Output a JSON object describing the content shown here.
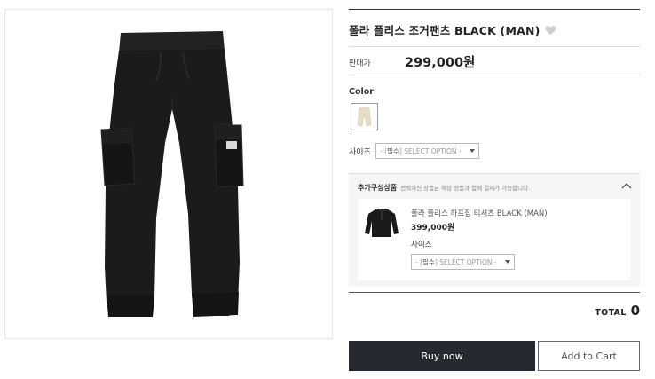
{
  "product": {
    "title": "폴라 플리스 조거팬츠 BLACK (MAN)",
    "price_label": "판매가",
    "price": "299,000원",
    "color_label": "Color",
    "size_label": "사이즈",
    "size_select": {
      "prefix": "- [",
      "required": "필수",
      "rest": "] SELECT OPTION -"
    }
  },
  "additional": {
    "header": "추가구성상품",
    "note": "선택하신 상품은 해당 상품과 함께 결제가 가능합니다.",
    "item": {
      "name": "폴라 플리스 하프집 티셔츠 BLACK (MAN)",
      "price": "399,000원",
      "size_label": "사이즈",
      "size_select": {
        "prefix": "- [",
        "required": "필수",
        "rest": "] SELECT OPTION -"
      }
    }
  },
  "summary": {
    "total_label": "TOTAL",
    "total_value": "0"
  },
  "actions": {
    "buy_now": "Buy now",
    "add_to_cart": "Add to Cart"
  },
  "icons": {
    "wishlist": "heart-icon",
    "collapse": "chevron-up-icon",
    "dropdown": "caret-down-icon"
  },
  "colors": {
    "garment_main": "#1b1b1b",
    "swatch_beige": "#e8dcc6",
    "buy_button": "#242a2f",
    "heart": "#cfcfcf"
  }
}
